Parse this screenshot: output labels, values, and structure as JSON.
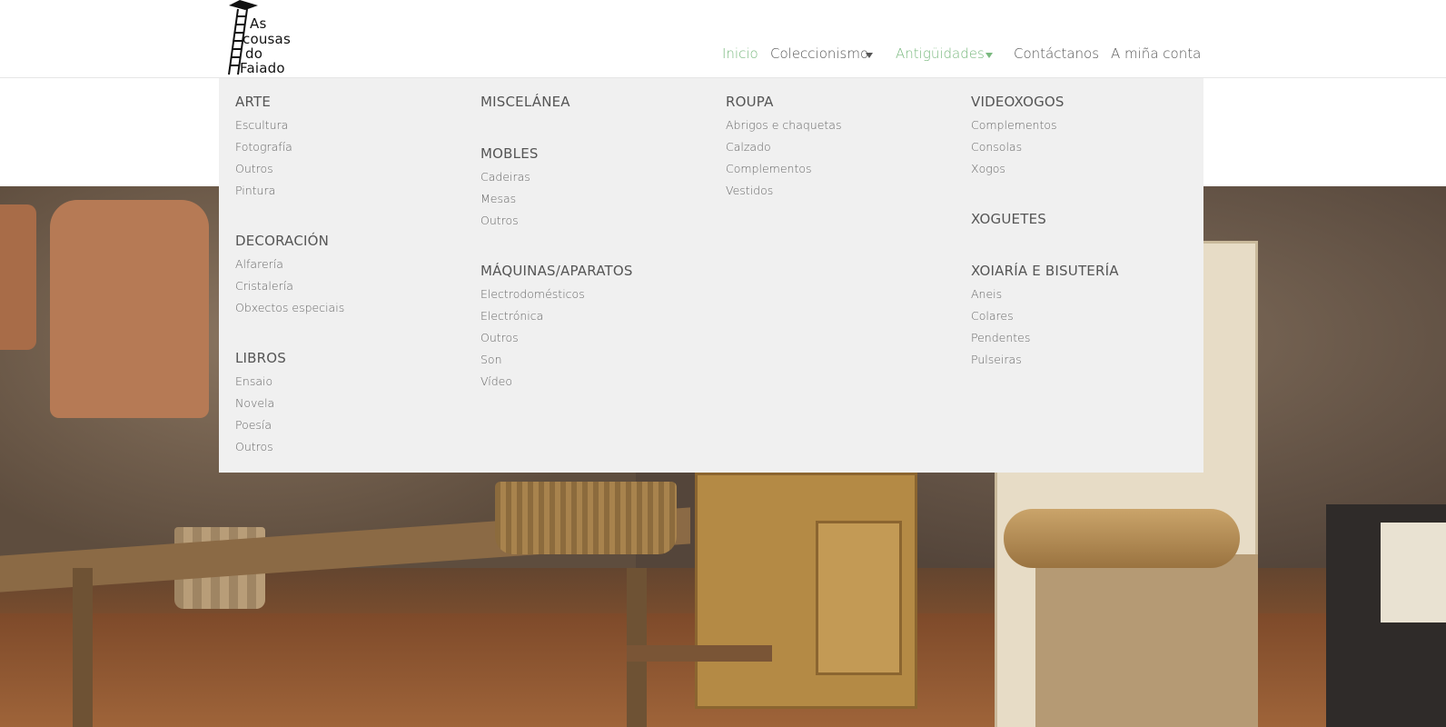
{
  "logo": {
    "lines": [
      "As",
      "cousas",
      "do",
      "Faiado"
    ]
  },
  "nav": {
    "items": [
      {
        "label": "Inicio",
        "active": true,
        "dropdown": false
      },
      {
        "label": "Coleccionismo",
        "active": false,
        "dropdown": true
      },
      {
        "label": "Antigüidades",
        "active": true,
        "dropdown": true
      },
      {
        "label": "Contáctanos",
        "active": false,
        "dropdown": false
      },
      {
        "label": "A miña conta",
        "active": false,
        "dropdown": false
      }
    ]
  },
  "colors": {
    "accent": "#7ab97f",
    "menu_bg": "#f0f0f0",
    "text": "#555555"
  },
  "mega_menu": {
    "columns": [
      {
        "groups": [
          {
            "title": "ARTE",
            "items": [
              "Escultura",
              "Fotografía",
              "Outros",
              "Pintura"
            ]
          },
          {
            "title": "DECORACIÓN",
            "items": [
              "Alfarería",
              "Cristalería",
              "Obxectos especiais"
            ]
          },
          {
            "title": "LIBROS",
            "items": [
              "Ensaio",
              "Novela",
              "Poesía",
              "Outros"
            ]
          }
        ]
      },
      {
        "groups": [
          {
            "title": "MISCELÁNEA",
            "items": []
          },
          {
            "title": "MOBLES",
            "items": [
              "Cadeiras",
              "Mesas",
              "Outros"
            ]
          },
          {
            "title": "MÁQUINAS/APARATOS",
            "items": [
              "Electrodomésticos",
              "Electrónica",
              "Outros",
              "Son",
              "Vídeo"
            ]
          }
        ]
      },
      {
        "groups": [
          {
            "title": "ROUPA",
            "items": [
              "Abrigos e chaquetas",
              "Calzado",
              "Complementos",
              "Vestidos"
            ]
          }
        ]
      },
      {
        "groups": [
          {
            "title": "VIDEOXOGOS",
            "items": [
              "Complementos",
              "Consolas",
              "Xogos"
            ]
          },
          {
            "title": "XOGUETES",
            "items": []
          },
          {
            "title": "XOIARÍA E BISUTERÍA",
            "items": [
              "Aneis",
              "Colares",
              "Pendentes",
              "Pulseiras"
            ]
          }
        ]
      }
    ]
  }
}
